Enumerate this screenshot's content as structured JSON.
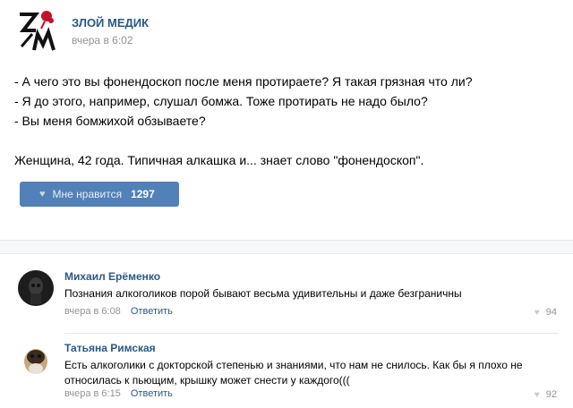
{
  "post": {
    "author": "ЗЛОЙ МЕДИК",
    "time": "вчера в 6:02",
    "lines": [
      "- А чего это вы фонендоскоп после меня протираете? Я такая грязная что ли?",
      "- Я до этого, например, слушал бомжа. Тоже протирать не надо было?",
      "- Вы меня бомжихой обзываете?",
      "Женщина, 42 года. Типичная алкашка и... знает слово \"фонендоскоп\"."
    ],
    "like_label": "Мне нравится",
    "like_count": "1297",
    "logo_text": "ЗЛМ"
  },
  "comments": [
    {
      "name": "Михаил Ерёменко",
      "text": "Познания алкоголиков порой бывают весьма удивительны и даже безграничны",
      "time": "вчера в 6:08",
      "reply": "Ответить",
      "likes": "94"
    },
    {
      "name": "Татьяна Римская",
      "text": "Есть алкоголики с докторской степенью и знаниями, что нам не снилось. Как бы я плохо не относилась к пьющим, крышку может снести у каждого(((",
      "time": "вчера в 6:15",
      "reply": "Ответить",
      "likes": "92"
    }
  ],
  "colors": {
    "link": "#2a5885",
    "like_button": "#5181b8",
    "meta": "#939393",
    "logo_red": "#c0122b"
  },
  "icons": [
    "heart-icon",
    "skull-avatar-icon",
    "pug-avatar-icon"
  ]
}
